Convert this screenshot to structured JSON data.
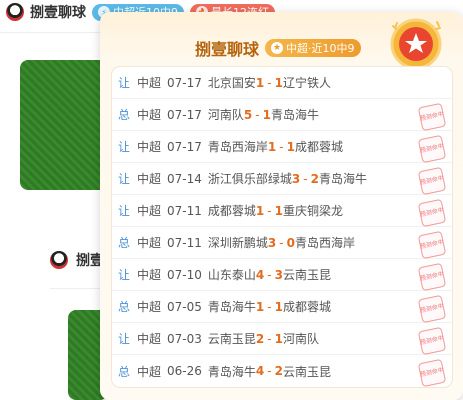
{
  "header": {
    "username": "捌壹聊球",
    "badges": [
      {
        "label": "中超近10中9",
        "color": "#5cb8e6"
      },
      {
        "label": "最长12连红",
        "color": "#f06c5c"
      }
    ]
  },
  "feed": {
    "username": "捌壹"
  },
  "popup": {
    "title": "捌壹聊球",
    "badge": "中超·近10中9",
    "stamp_text": "预测命中",
    "rows": [
      {
        "type": "让",
        "league": "中超",
        "date": "07-17",
        "home": "北京国安",
        "hs": "1",
        "as": "1",
        "away": "辽宁铁人",
        "hit": false
      },
      {
        "type": "总",
        "league": "中超",
        "date": "07-17",
        "home": "河南队",
        "hs": "5",
        "as": "1",
        "away": "青岛海牛",
        "hit": true
      },
      {
        "type": "让",
        "league": "中超",
        "date": "07-17",
        "home": "青岛西海岸",
        "hs": "1",
        "as": "1",
        "away": "成都蓉城",
        "hit": true
      },
      {
        "type": "让",
        "league": "中超",
        "date": "07-14",
        "home": "浙江俱乐部绿城",
        "hs": "3",
        "as": "2",
        "away": "青岛海牛",
        "hit": true
      },
      {
        "type": "让",
        "league": "中超",
        "date": "07-11",
        "home": "成都蓉城",
        "hs": "1",
        "as": "1",
        "away": "重庆铜梁龙",
        "hit": true
      },
      {
        "type": "总",
        "league": "中超",
        "date": "07-11",
        "home": "深圳新鹏城",
        "hs": "3",
        "as": "0",
        "away": "青岛西海岸",
        "hit": true
      },
      {
        "type": "让",
        "league": "中超",
        "date": "07-10",
        "home": "山东泰山",
        "hs": "4",
        "as": "3",
        "away": "云南玉昆",
        "hit": true
      },
      {
        "type": "总",
        "league": "中超",
        "date": "07-05",
        "home": "青岛海牛",
        "hs": "1",
        "as": "1",
        "away": "成都蓉城",
        "hit": true
      },
      {
        "type": "让",
        "league": "中超",
        "date": "07-03",
        "home": "云南玉昆",
        "hs": "2",
        "as": "1",
        "away": "河南队",
        "hit": true
      },
      {
        "type": "总",
        "league": "中超",
        "date": "06-26",
        "home": "青岛海牛",
        "hs": "4",
        "as": "2",
        "away": "云南玉昆",
        "hit": true
      }
    ]
  }
}
